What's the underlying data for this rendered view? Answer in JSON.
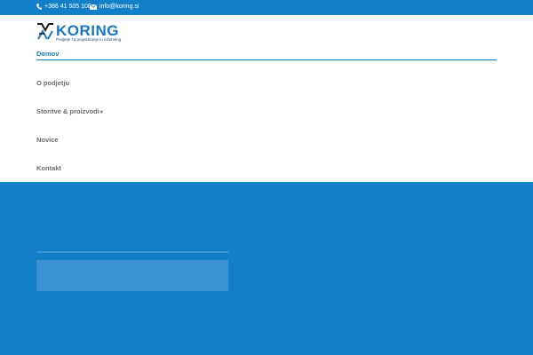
{
  "topbar": {
    "phone": "+386 41 505 108",
    "email": "info@koring.si",
    "phone_icon": "phone-icon",
    "email_icon": "envelope-icon"
  },
  "logo": {
    "wordmark": "KORING",
    "tagline": "Podjetje za projektiranje in inženiring"
  },
  "nav": {
    "items": [
      {
        "label": "Domov",
        "active": true
      },
      {
        "label": "O podjetju"
      },
      {
        "label": "Storitve & proizvodi",
        "has_submenu": true
      },
      {
        "label": "Novice"
      },
      {
        "label": "Kontakt"
      }
    ],
    "caret": "▾"
  },
  "colors": {
    "brand_blue": "#147fc9",
    "accent_blue": "#1a78c2",
    "nav_text": "#6b6b6b"
  }
}
